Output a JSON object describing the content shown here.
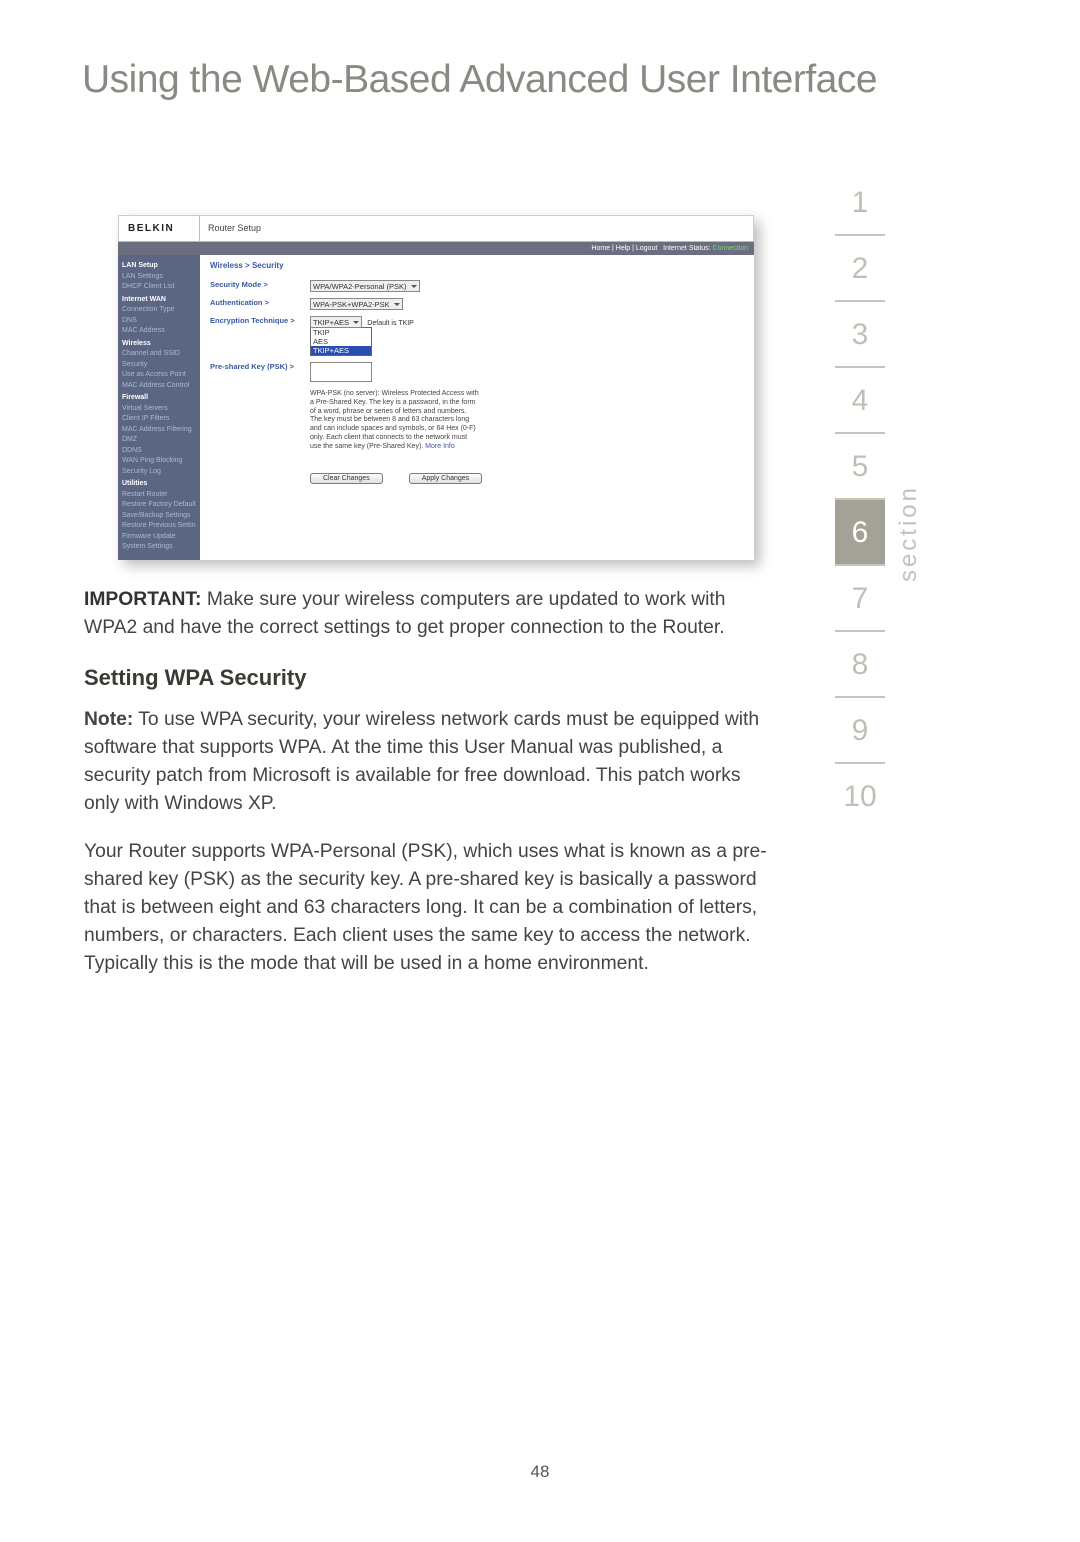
{
  "title": "Using the Web-Based Advanced User Interface",
  "section_label": "section",
  "section_nav": [
    "1",
    "2",
    "3",
    "4",
    "5",
    "6",
    "7",
    "8",
    "9",
    "10"
  ],
  "active_section": "6",
  "page_number": "48",
  "screenshot": {
    "brand": "BELKIN",
    "router_setup": "Router Setup",
    "statusbar": {
      "links": "Home | Help | Logout",
      "label": "Internet Status:",
      "status": "Connection"
    },
    "sidebar": {
      "items": [
        {
          "label": "LAN Setup",
          "hdr": true
        },
        {
          "label": "LAN Settings"
        },
        {
          "label": "DHCP Client List"
        },
        {
          "label": "Internet WAN",
          "hdr": true
        },
        {
          "label": "Connection Type"
        },
        {
          "label": "DNS"
        },
        {
          "label": "MAC Address"
        },
        {
          "label": "Wireless",
          "hdr": true
        },
        {
          "label": "Channel and SSID"
        },
        {
          "label": "Security"
        },
        {
          "label": "Use as Access Point"
        },
        {
          "label": "MAC Address Control"
        },
        {
          "label": "Firewall",
          "hdr": true
        },
        {
          "label": "Virtual Servers"
        },
        {
          "label": "Client IP Filters"
        },
        {
          "label": "MAC Address Filtering"
        },
        {
          "label": "DMZ"
        },
        {
          "label": "DDNS"
        },
        {
          "label": "WAN Ping Blocking"
        },
        {
          "label": "Security Log"
        },
        {
          "label": "Utilities",
          "hdr": true
        },
        {
          "label": "Restart Router"
        },
        {
          "label": "Restore Factory Defaults"
        },
        {
          "label": "Save/Backup Settings"
        },
        {
          "label": "Restore Previous Settings"
        },
        {
          "label": "Firmware Update"
        },
        {
          "label": "System Settings"
        }
      ]
    },
    "breadcrumb": "Wireless > Security",
    "rows": {
      "security_mode": {
        "label": "Security Mode >",
        "value": "WPA/WPA2-Personal (PSK)"
      },
      "authentication": {
        "label": "Authentication >",
        "value": "WPA-PSK+WPA2-PSK"
      },
      "encryption": {
        "label": "Encryption Technique >",
        "value": "TKIP+AES",
        "default_note": "Default is TKIP",
        "options": [
          "TKIP",
          "AES",
          "TKIP+AES"
        ]
      },
      "psk": {
        "label": "Pre-shared Key (PSK) >"
      }
    },
    "help_text": "WPA-PSK (no server): Wireless Protected Access with a Pre-Shared Key. The key is a password, in the form of a word, phrase or series of letters and numbers. The key must be between 8 and 63 characters long and can include spaces and symbols, or 64 Hex (0-F) only. Each client that connects to the network must use the same key (Pre-Shared Key).",
    "help_link": "More Info",
    "buttons": {
      "clear": "Clear Changes",
      "apply": "Apply Changes"
    }
  },
  "body": {
    "important_label": "IMPORTANT:",
    "important_text": " Make sure your wireless computers are updated to work with WPA2 and have the correct settings to get proper connection to the Router.",
    "heading": "Setting WPA Security",
    "note_label": "Note:",
    "note_text": " To use WPA security, your wireless network cards must be equipped with software that supports WPA. At the time this User Manual was published, a security patch from Microsoft is available for free download. This patch works only with Windows XP.",
    "para2": "Your Router supports WPA-Personal (PSK), which uses what is known as a pre-shared key (PSK) as the security key. A pre-shared key is basically a password that is between eight and 63 characters long. It can be a combination of letters, numbers, or characters. Each client uses the same key to access the network. Typically this is the mode that will be used in a home environment."
  }
}
